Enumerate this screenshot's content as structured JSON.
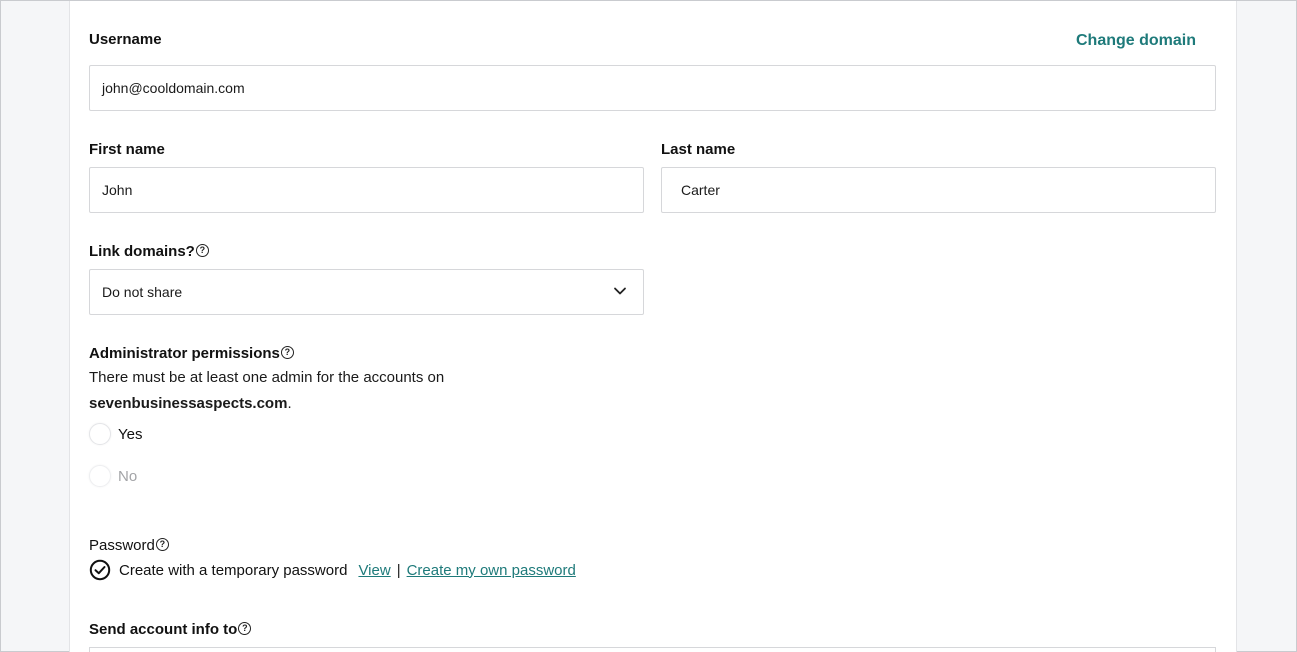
{
  "form": {
    "username": {
      "label": "Username",
      "value": "john@cooldomain.com",
      "change_domain_label": "Change domain"
    },
    "first_name": {
      "label": "First name",
      "value": "John"
    },
    "last_name": {
      "label": "Last name",
      "value": "Carter"
    },
    "link_domains": {
      "label": "Link domains?",
      "help_icon": "help-circle-icon",
      "selected": "Do not share"
    },
    "admin": {
      "label": "Administrator permissions",
      "description_prefix": "There must be at least one admin for the accounts on",
      "domain": "sevenbusinessaspects.com",
      "description_suffix": ".",
      "options": [
        "Yes",
        "No"
      ]
    },
    "password": {
      "label": "Password",
      "status_text": "Create with a temporary password",
      "view_link": "View",
      "separator": "|",
      "create_own_link": "Create my own password"
    },
    "send_info": {
      "label": "Send account info to"
    }
  },
  "colors": {
    "accent": "#1e7a7a",
    "border": "#d6d7da",
    "background": "#f5f6f8"
  }
}
